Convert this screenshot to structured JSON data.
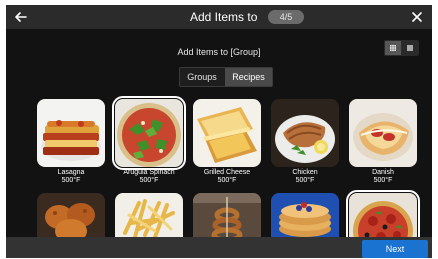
{
  "header": {
    "title": "Add Items to",
    "step": "4/5"
  },
  "main": {
    "subtitle": "Add Items to [Group]",
    "tabs": [
      {
        "label": "Groups",
        "active": false
      },
      {
        "label": "Recipes",
        "active": true
      }
    ],
    "view_mode": "grid",
    "recipes": [
      {
        "name": "Lasagna",
        "temp": "500°F",
        "selected": false
      },
      {
        "name": "Arugula Spinach",
        "temp": "500°F",
        "selected": true
      },
      {
        "name": "Grilled Cheese",
        "temp": "500°F",
        "selected": false
      },
      {
        "name": "Chicken",
        "temp": "500°F",
        "selected": false
      },
      {
        "name": "Danish",
        "temp": "500°F",
        "selected": false
      }
    ],
    "second_row_items": [
      "fried-chicken",
      "french-fries",
      "onion-rings",
      "pancakes",
      "pizza"
    ],
    "second_row_selected_index": 4
  },
  "footer": {
    "next_label": "Next"
  },
  "colors": {
    "accent": "#1a73d0",
    "background": "#121212",
    "titlebar": "#2b2b2b"
  }
}
